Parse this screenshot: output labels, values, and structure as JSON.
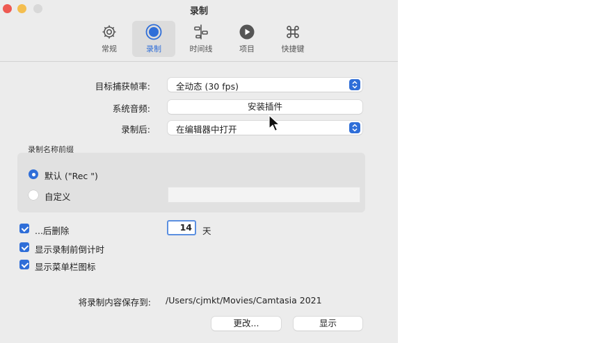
{
  "window": {
    "title": "录制"
  },
  "toolbar": {
    "tabs": [
      {
        "label": "常规",
        "icon": "gear-icon"
      },
      {
        "label": "录制",
        "icon": "record-icon"
      },
      {
        "label": "时间线",
        "icon": "timeline-icon"
      },
      {
        "label": "项目",
        "icon": "play-icon"
      },
      {
        "label": "快捷键",
        "icon": "command-key-icon"
      }
    ],
    "active_tab": "录制"
  },
  "form": {
    "frame_rate": {
      "label": "目标捕获帧率:",
      "value": "全动态 (30 fps)"
    },
    "system_audio": {
      "label": "系统音频:",
      "button": "安装插件"
    },
    "after_recording": {
      "label": "录制后:",
      "value": "在编辑器中打开"
    }
  },
  "prefix": {
    "section_title": "录制名称前缀",
    "default_option": "默认 (\"Rec \")",
    "custom_option": "自定义",
    "custom_value": "",
    "selected": "default"
  },
  "options": {
    "delete_after": {
      "label": "...后删除",
      "checked": true,
      "days": "14",
      "unit": "天"
    },
    "countdown": {
      "label": "显示录制前倒计时",
      "checked": true
    },
    "menubar_icon": {
      "label": "显示菜单栏图标",
      "checked": true
    }
  },
  "save": {
    "label": "将录制内容保存到:",
    "path": "/Users/cjmkt/Movies/Camtasia 2021",
    "change_button": "更改...",
    "show_button": "显示"
  },
  "colors": {
    "accent": "#2f6ed8",
    "window_bg": "#ececec"
  }
}
